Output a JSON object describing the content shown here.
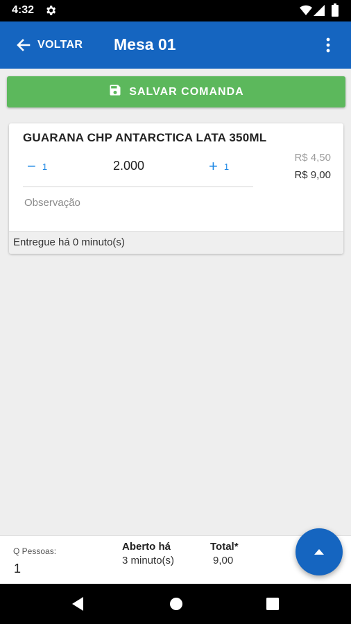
{
  "status_bar": {
    "time": "4:32",
    "icons": [
      "gear-icon",
      "wifi-icon",
      "signal-icon",
      "battery-icon"
    ]
  },
  "app_bar": {
    "back_label": "VOLTAR",
    "title": "Mesa 01",
    "color": "#1565c0",
    "icons": [
      "arrow-left-icon",
      "more-vertical-icon"
    ]
  },
  "actions": {
    "save_label": "SALVAR COMANDA",
    "save_color": "#5cb85c",
    "save_icon": "floppy-disk-icon"
  },
  "order_items": [
    {
      "name": "GUARANA CHP ANTARCTICA LATA 350ML",
      "decrement_symbol": "−",
      "decrement_step": "1",
      "quantity": "2.000",
      "increment_symbol": "+",
      "increment_step": "1",
      "unit_price": "R$ 4,50",
      "total_price": "R$ 9,00",
      "observation_placeholder": "Observação",
      "observation_value": "",
      "status": "Entregue há 0 minuto(s)"
    }
  ],
  "summary": {
    "people_label": "Q Pessoas:",
    "people_value": "1",
    "opened_label": "Aberto há",
    "opened_value": "3 minuto(s)",
    "total_label": "Total*",
    "total_value": "9,00"
  },
  "fab": {
    "icon": "caret-up-icon",
    "color": "#1565c0"
  },
  "nav_bar": {
    "icons": [
      "nav-back-icon",
      "nav-home-icon",
      "nav-recents-icon"
    ]
  }
}
